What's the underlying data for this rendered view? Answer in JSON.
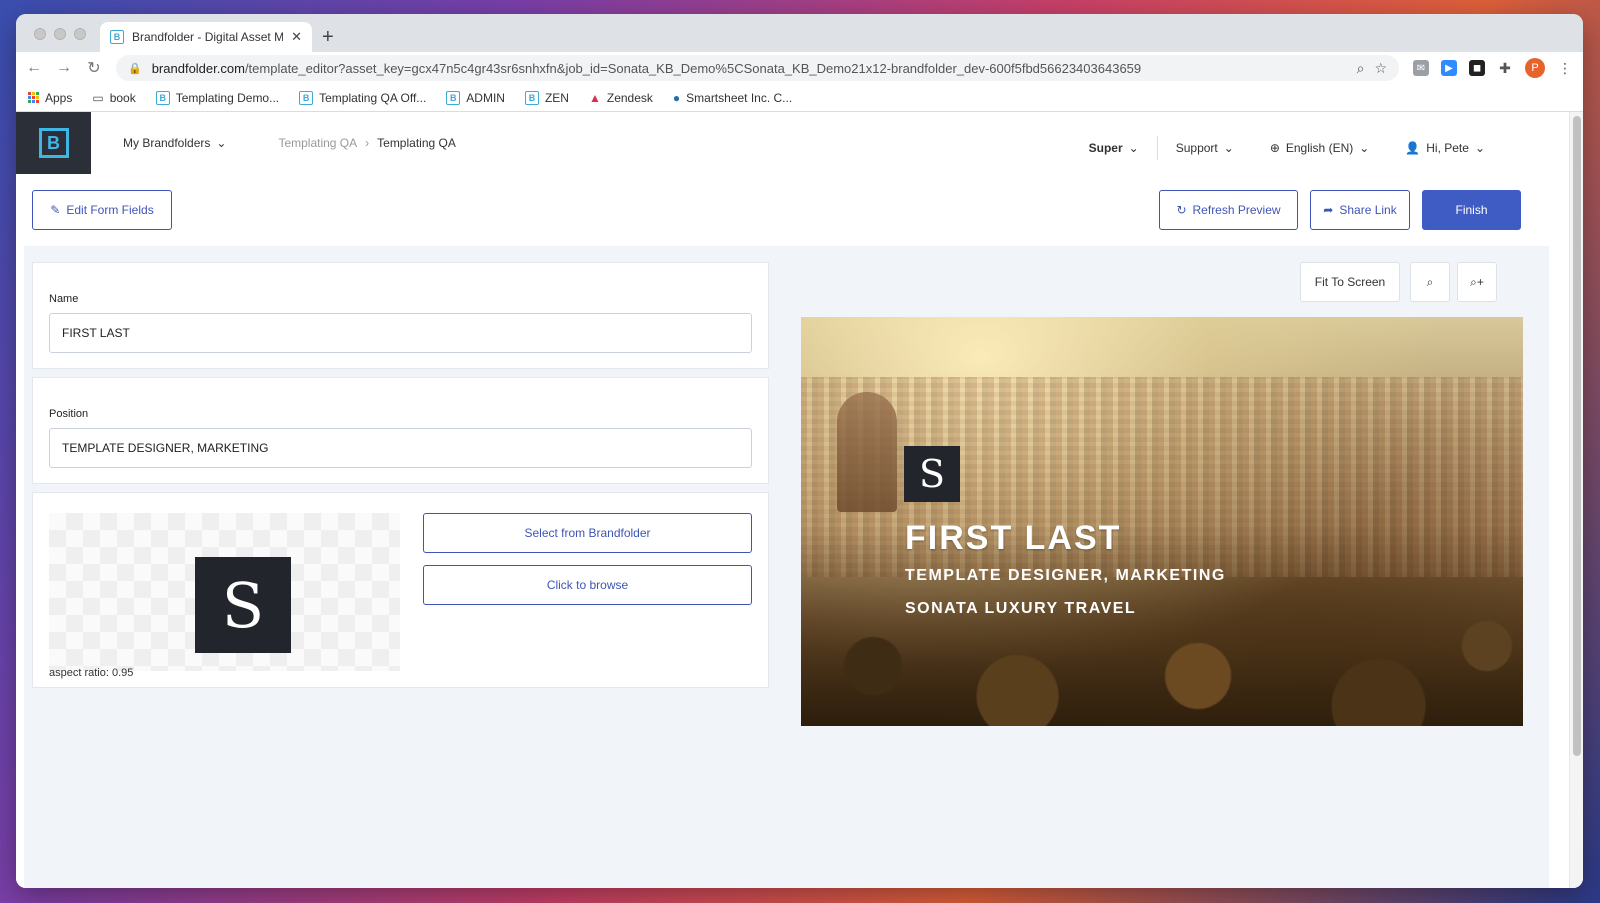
{
  "browser": {
    "tab_title": "Brandfolder - Digital Asset Mar",
    "url_host": "brandfolder.com",
    "url_path": "/template_editor?asset_key=gcx47n5c4gr43sr6snhxfn&job_id=Sonata_KB_Demo%5CSonata_KB_Demo21x12-brandfolder_dev-600f5fbd56623403643659",
    "bookmarks": [
      {
        "label": "Apps"
      },
      {
        "label": "book"
      },
      {
        "label": "Templating Demo..."
      },
      {
        "label": "Templating QA Off..."
      },
      {
        "label": "ADMIN"
      },
      {
        "label": "ZEN"
      },
      {
        "label": "Zendesk"
      },
      {
        "label": "Smartsheet Inc. C..."
      }
    ],
    "profile_initial": "P"
  },
  "header": {
    "logo_letter": "B",
    "my_brandfolders": "My Brandfolders",
    "breadcrumb": [
      "Templating QA",
      "Templating QA"
    ],
    "super": "Super",
    "support": "Support",
    "language": "English (EN)",
    "greeting": "Hi, Pete"
  },
  "toolbar": {
    "edit_form_fields": "Edit Form Fields",
    "refresh_preview": "Refresh Preview",
    "share_link": "Share Link",
    "finish": "Finish"
  },
  "form": {
    "name_label": "Name",
    "name_value": "FIRST LAST",
    "position_label": "Position",
    "position_value": "TEMPLATE DESIGNER, MARKETING",
    "logo_letter": "S",
    "aspect_ratio": "aspect ratio: 0.95",
    "select_from_brandfolder": "Select from Brandfolder",
    "click_to_browse": "Click to browse"
  },
  "preview": {
    "fit_to_screen": "Fit To Screen",
    "logo_letter": "S",
    "name": "FIRST LAST",
    "position": "TEMPLATE DESIGNER, MARKETING",
    "company": "SONATA LUXURY TRAVEL"
  },
  "colors": {
    "primary": "#3f5bc4",
    "brand_cyan": "#3fb6e8",
    "logo_bg": "#2a2f38"
  }
}
